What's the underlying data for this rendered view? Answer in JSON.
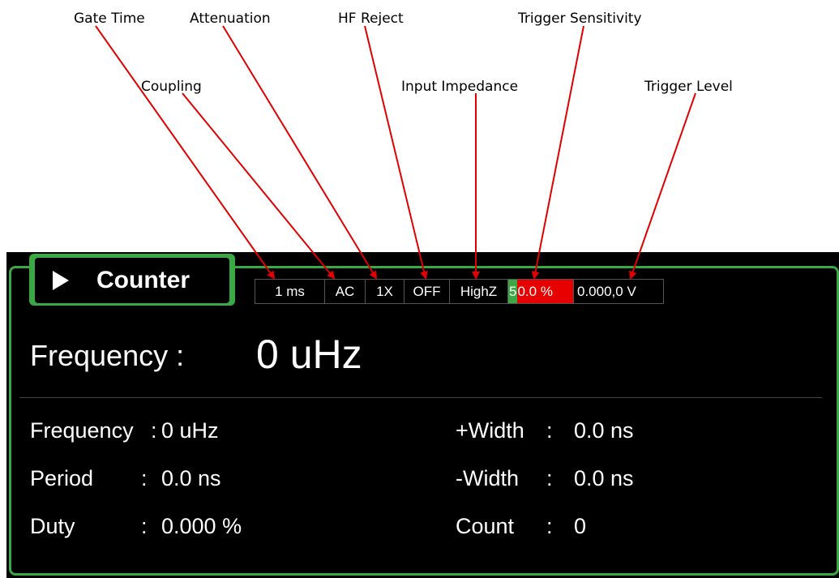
{
  "callouts": {
    "gate_time": "Gate Time",
    "attenuation": "Attenuation",
    "hf_reject": "HF Reject",
    "trigger_sensitivity": "Trigger Sensitivity",
    "coupling": "Coupling",
    "input_impedance": "Input Impedance",
    "trigger_level": "Trigger Level"
  },
  "panel": {
    "title": "Counter",
    "params": {
      "gate_time": "1 ms",
      "coupling": "AC",
      "attenuation": "1X",
      "hf_reject": "OFF",
      "impedance": "HighZ",
      "sensitivity_cursor": "5",
      "sensitivity_rest": "0.0 %",
      "trigger_level": "0.000,0 V"
    },
    "main": {
      "label": "Frequency :",
      "value": "0 uHz"
    },
    "left_measurements": [
      {
        "name": "Frequency",
        "sep": ":",
        "value": "0 uHz"
      },
      {
        "name": "Period",
        "sep": ":",
        "value": "0.0 ns"
      },
      {
        "name": "Duty",
        "sep": ":",
        "value": "0.000 %"
      }
    ],
    "right_measurements": [
      {
        "name": "+Width",
        "sep": ":",
        "value": "0.0 ns"
      },
      {
        "name": "-Width",
        "sep": ":",
        "value": "0.0 ns"
      },
      {
        "name": "Count",
        "sep": ":",
        "value": "0"
      }
    ]
  },
  "colors": {
    "accent_green": "#3aa944",
    "highlight_red": "#e60000",
    "arrow_red": "#e00000"
  }
}
